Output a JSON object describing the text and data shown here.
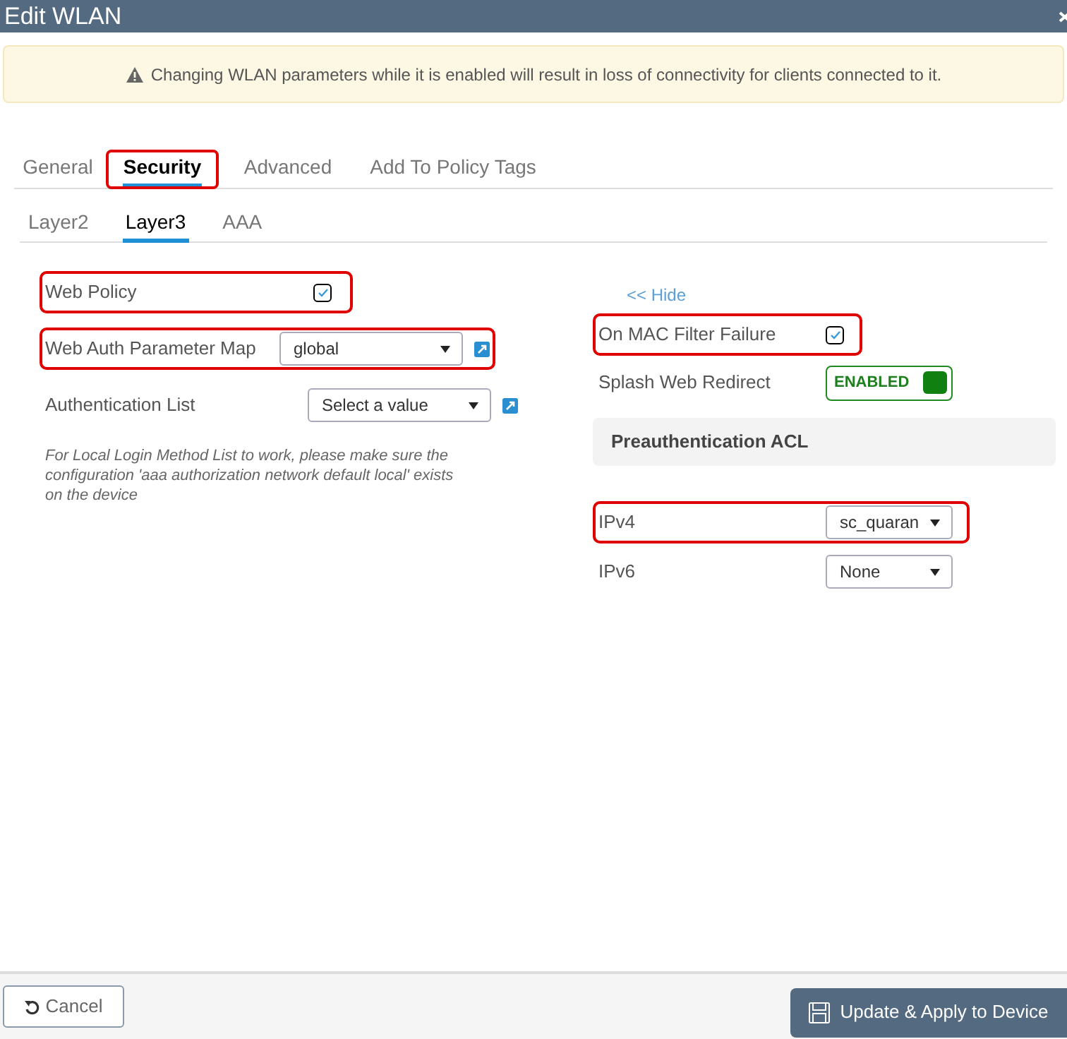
{
  "window": {
    "title": "Edit WLAN"
  },
  "banner": {
    "text": "Changing WLAN parameters while it is enabled will result in loss of connectivity for clients connected to it."
  },
  "tabs": [
    {
      "label": "General",
      "selected": false,
      "highlighted": false
    },
    {
      "label": "Security",
      "selected": true,
      "highlighted": true
    },
    {
      "label": "Advanced",
      "selected": false,
      "highlighted": false
    },
    {
      "label": "Add To Policy Tags",
      "selected": false,
      "highlighted": false
    }
  ],
  "subtabs": [
    {
      "label": "Layer2",
      "selected": false
    },
    {
      "label": "Layer3",
      "selected": true
    },
    {
      "label": "AAA",
      "selected": false
    }
  ],
  "left_fields": [
    {
      "kind": "checkbox",
      "label": "Web Policy",
      "checked": true,
      "highlighted": true
    },
    {
      "kind": "select",
      "label": "Web Auth Parameter Map",
      "value": "global",
      "highlighted": true,
      "link": true
    },
    {
      "kind": "select",
      "label": "Authentication List",
      "value": "Select a value",
      "highlighted": false,
      "link": true
    }
  ],
  "note": "For Local Login Method List to work, please make sure the configuration 'aaa authorization network default local' exists on the device",
  "hide_link": "<< Hide",
  "right_fields": [
    {
      "kind": "checkbox",
      "label": "On MAC Filter Failure",
      "checked": true,
      "highlighted": true
    },
    {
      "kind": "toggle",
      "label": "Splash Web Redirect",
      "value": "ENABLED",
      "on": true,
      "highlighted": false
    }
  ],
  "acl_section": {
    "title": "Preauthentication ACL",
    "fields": [
      {
        "kind": "select",
        "label": "IPv4",
        "value": "sc_quaran",
        "highlighted": true,
        "link": false
      },
      {
        "kind": "select",
        "label": "IPv6",
        "value": "None",
        "highlighted": false,
        "link": false
      }
    ]
  },
  "buttons": [
    {
      "kind": "cancel",
      "label": "Cancel"
    },
    {
      "kind": "apply",
      "label": "Update & Apply to Device"
    }
  ]
}
